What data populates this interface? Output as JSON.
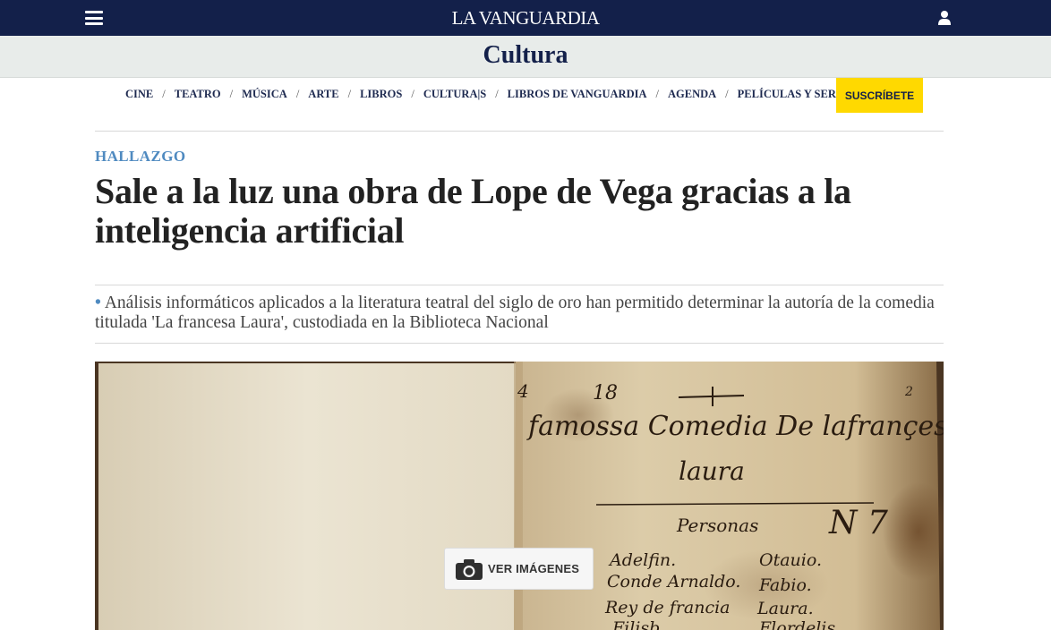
{
  "header": {
    "logo": "LA VANGUARDIA",
    "menu_icon": "hamburger-menu-icon",
    "user_icon": "user-icon",
    "bar_color": "#13204a"
  },
  "section": {
    "title": "Cultura",
    "band_color": "#e8ecea"
  },
  "nav": {
    "items": [
      "CINE",
      "TEATRO",
      "MÚSICA",
      "ARTE",
      "LIBROS",
      "CULTURA|S",
      "LIBROS DE VANGUARDIA",
      "AGENDA",
      "PELÍCULAS Y SERIES"
    ],
    "separator": "/",
    "subscribe_label": "SUSCRÍBETE",
    "subscribe_color": "#ffd900"
  },
  "article": {
    "kicker": "HALLAZGO",
    "kicker_color": "#4f8ac0",
    "headline": "Sale a la luz una obra de Lope de Vega gracias a la inteligencia artificial",
    "summary_bullet": "•",
    "summary": "Análisis informáticos aplicados a la literatura teatral del siglo de oro han permitido determinar la autoría de la comedia titulada 'La francesa Laura', custodiada en la Biblioteca Nacional"
  },
  "media": {
    "manuscript": {
      "number_top_left": "4",
      "number_top": "18",
      "number_top_right": "2",
      "line1": "famossa Comedia De lafrançessa",
      "line2": "laura",
      "line3": "Personas",
      "number_right": "N 7",
      "left_names": [
        "Adelfin.",
        "Conde Arnaldo.",
        "Rey de francia",
        "Filisb."
      ],
      "right_names": [
        "Otauio.",
        "Fabio.",
        "Laura.",
        "Flordelis"
      ]
    },
    "view_images_label": "VER IMÁGENES",
    "camera_icon": "camera-icon"
  }
}
